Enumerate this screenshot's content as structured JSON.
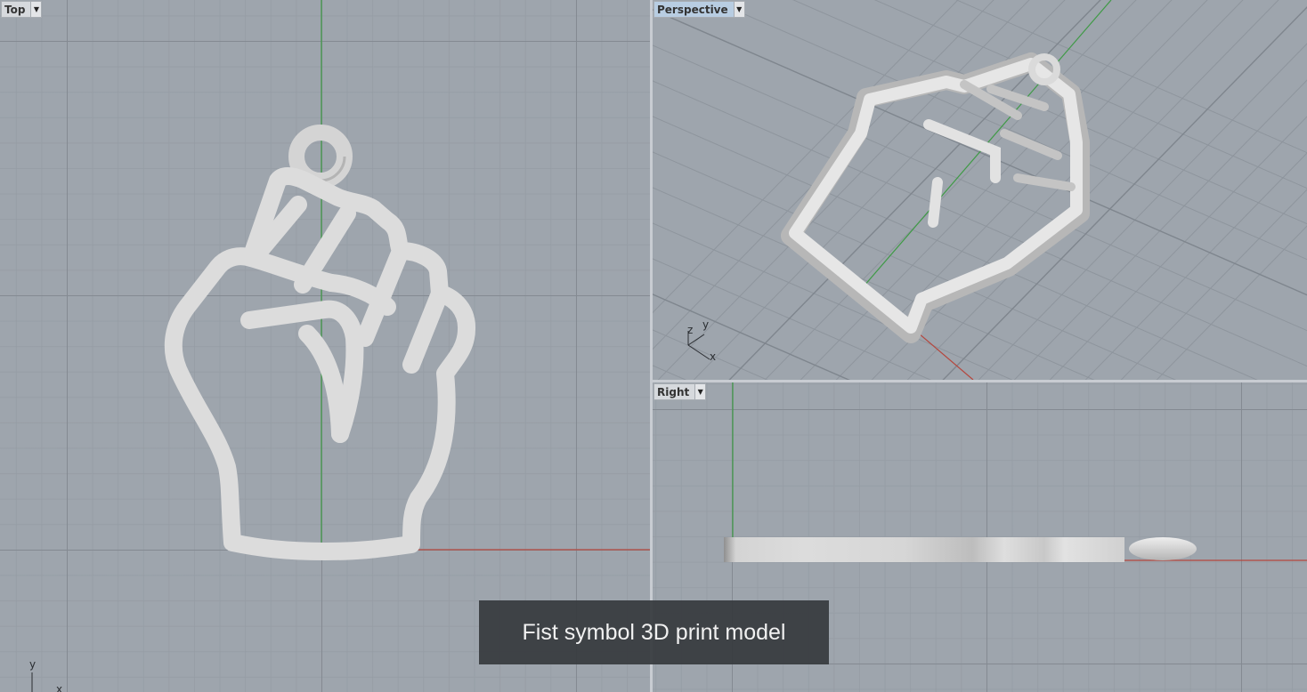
{
  "viewports": {
    "top": {
      "label": "Top",
      "axes": {
        "y": "y",
        "x": "x"
      }
    },
    "perspective": {
      "label": "Perspective",
      "axes": {
        "z": "z",
        "y": "y",
        "x": "x"
      }
    },
    "right": {
      "label": "Right"
    }
  },
  "caption": "Fist symbol 3D print model",
  "icons": {
    "dropdown": "small-down-triangle-icon"
  },
  "colors": {
    "viewport_bg": "#9ea5ad",
    "model": "#dcdcdc",
    "x_axis": "#b5473e",
    "y_axis": "#3f9a46",
    "active_label": "#b8cde2"
  }
}
